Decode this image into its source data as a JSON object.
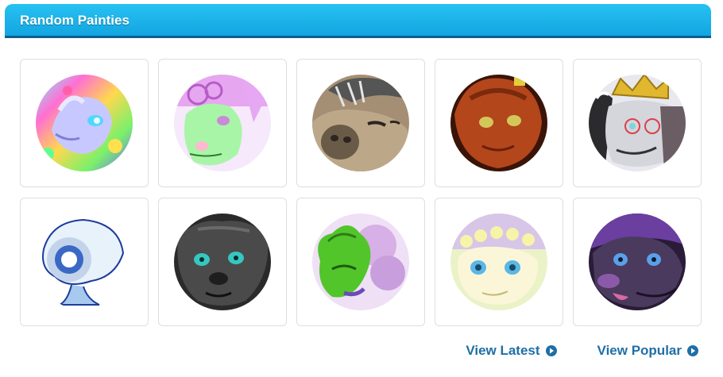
{
  "section": {
    "title": "Random Painties"
  },
  "avatars": [
    {
      "icon": "rainbow-dragon-avatar-icon"
    },
    {
      "icon": "pastel-green-creature-avatar-icon"
    },
    {
      "icon": "tan-seal-avatar-icon"
    },
    {
      "icon": "orange-dragon-avatar-icon"
    },
    {
      "icon": "crowned-creature-avatar-icon"
    },
    {
      "icon": "white-eyeball-creature-avatar-icon"
    },
    {
      "icon": "black-cat-avatar-icon"
    },
    {
      "icon": "green-frog-creature-avatar-icon"
    },
    {
      "icon": "flower-crown-creature-avatar-icon"
    },
    {
      "icon": "purple-dark-creature-avatar-icon"
    }
  ],
  "links": {
    "latest": "View Latest",
    "popular": "View Popular"
  },
  "colors": {
    "header_gradient_top": "#27c2f2",
    "header_gradient_bottom": "#13a5e1",
    "link": "#1f6fa6"
  }
}
